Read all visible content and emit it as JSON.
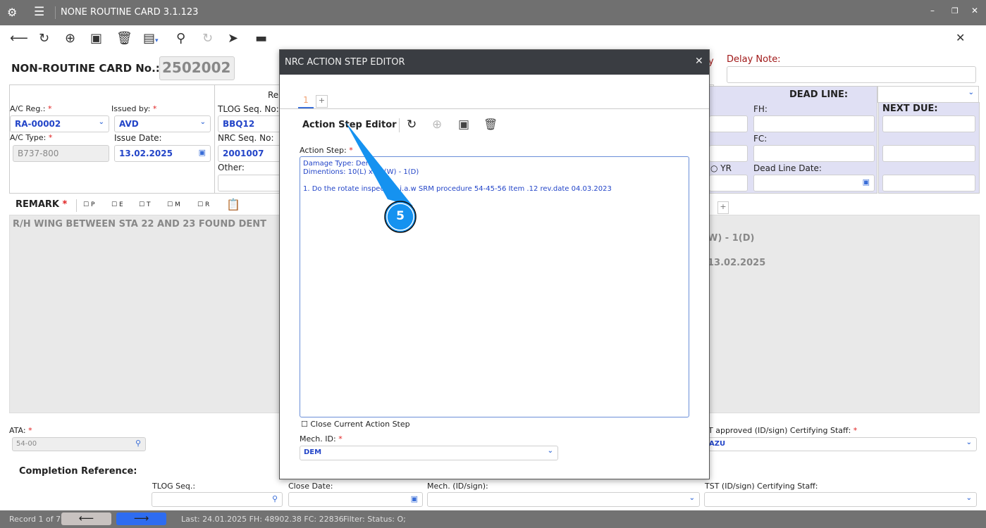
{
  "window": {
    "title": "NONE ROUTINE CARD 3.1.123"
  },
  "card": {
    "label": "NON-ROUTINE CARD No.:",
    "number": "2502002"
  },
  "form": {
    "ac_reg_label": "A/C Reg.:",
    "ac_reg": "RA-00002",
    "issued_by_label": "Issued by:",
    "issued_by": "AVD",
    "ac_type_label": "A/C Type:",
    "ac_type": "B737-800",
    "issue_date_label": "Issue Date:",
    "issue_date": "13.02.2025",
    "ref_label": "Re",
    "tlog_label": "TLOG Seq. No:",
    "tlog": "BBQ12",
    "nrc_seq_label": "NRC Seq. No:",
    "nrc_seq": "2001007",
    "other_label": "Other:",
    "delay_partial": "y",
    "delay_note_label": "Delay Note:",
    "deadline_label": "DEAD LINE:",
    "next_due_label": "NEXT DUE:",
    "fh_label": "FH:",
    "fc_label": "FC:",
    "yr_label": "YR",
    "dead_line_date_label": "Dead Line Date:"
  },
  "remark": {
    "label": "REMARK",
    "checks": [
      "P",
      "E",
      "T",
      "M",
      "R"
    ],
    "text": "R/H WING BETWEEN STA 22 AND 23 FOUND DENT",
    "right_line1": "W) - 1(D)",
    "right_line2": "13.02.2025"
  },
  "ata": {
    "label": "ATA:",
    "value": "54-00"
  },
  "tst": {
    "label": "T approved (ID/sign) Certifying Staff:",
    "value": "AZU"
  },
  "completion": {
    "title": "Completion Reference:",
    "tlog_label": "TLOG Seq.:",
    "close_date_label": "Close Date:",
    "mech_label": "Mech. (ID/sign):",
    "tst_label": "TST (ID/sign) Certifying Staff:"
  },
  "modal": {
    "title": "NRC ACTION STEP EDITOR",
    "tab": "1",
    "add_tab": "+",
    "editor_title": "Action Step Editor",
    "action_label": "Action Step:",
    "action_text": "Damage Type: Dent\nDimentions: 10(L) x 10(W) - 1(D)\n\n1. Do the rotate inspection i.a.w SRM procedure 54-45-56 Item .12 rev.date 04.03.2023",
    "close_step_label": "Close Current Action Step",
    "mech_label": "Mech. ID:",
    "mech_value": "DEM"
  },
  "callout": {
    "number": "5"
  },
  "status": {
    "record": "Record 1 of 79",
    "last": "Last: 24.01.2025 FH: 48902.38 FC: 22836",
    "filter": "Filter: Status: O;"
  }
}
